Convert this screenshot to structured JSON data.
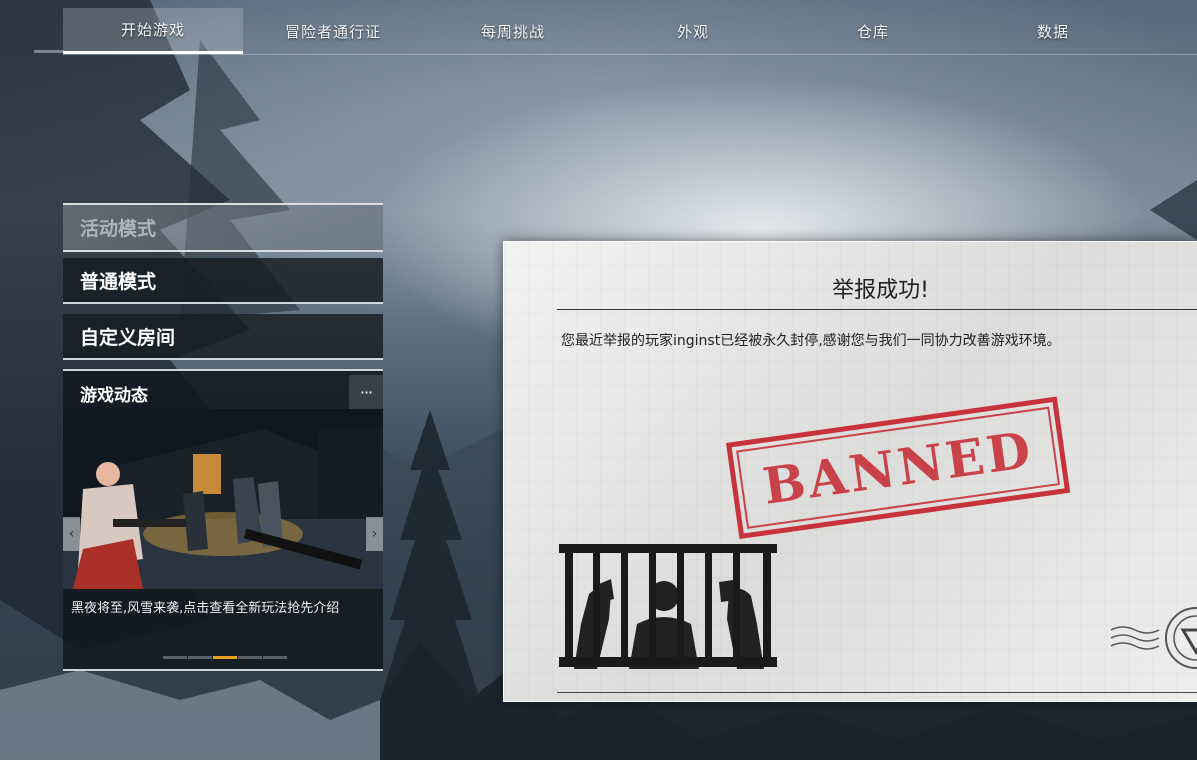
{
  "nav": {
    "tabs": [
      {
        "label": "开始游戏",
        "active": true
      },
      {
        "label": "冒险者通行证"
      },
      {
        "label": "每周挑战"
      },
      {
        "label": "外观"
      },
      {
        "label": "仓库"
      },
      {
        "label": "数据"
      }
    ]
  },
  "menu": {
    "activity_mode": "活动模式",
    "normal_mode": "普通模式",
    "custom_room": "自定义房间"
  },
  "news": {
    "title": "游戏动态",
    "more": "···",
    "caption": "黑夜将至,风雪来袭,点击查看全新玩法抢先介绍",
    "dots_total": 5,
    "active_dot": 3
  },
  "dialog": {
    "title": "举报成功!",
    "message": "您最近举报的玩家inginst已经被永久封停,感谢您与我们一同协力改善游戏环境。",
    "stamp": "BANNED"
  },
  "colors": {
    "accent": "#f0a020",
    "stamp": "#c8323a"
  }
}
